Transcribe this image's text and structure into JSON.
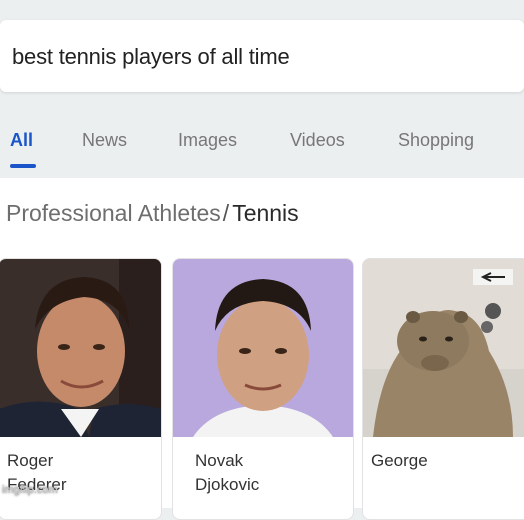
{
  "search": {
    "query": "best tennis players of all time"
  },
  "tabs": [
    {
      "label": "All",
      "active": true
    },
    {
      "label": "News",
      "active": false
    },
    {
      "label": "Images",
      "active": false
    },
    {
      "label": "Videos",
      "active": false
    },
    {
      "label": "Shopping",
      "active": false
    }
  ],
  "panel": {
    "category": "Professional Athletes",
    "separator": "/",
    "subcategory": "Tennis"
  },
  "results": [
    {
      "name": "Roger Federer"
    },
    {
      "name": "Novak Djokovic"
    },
    {
      "name": "George"
    }
  ],
  "watermark": "imgflip.com",
  "colors": {
    "accent": "#1a56c9",
    "background": "#eceff0"
  }
}
